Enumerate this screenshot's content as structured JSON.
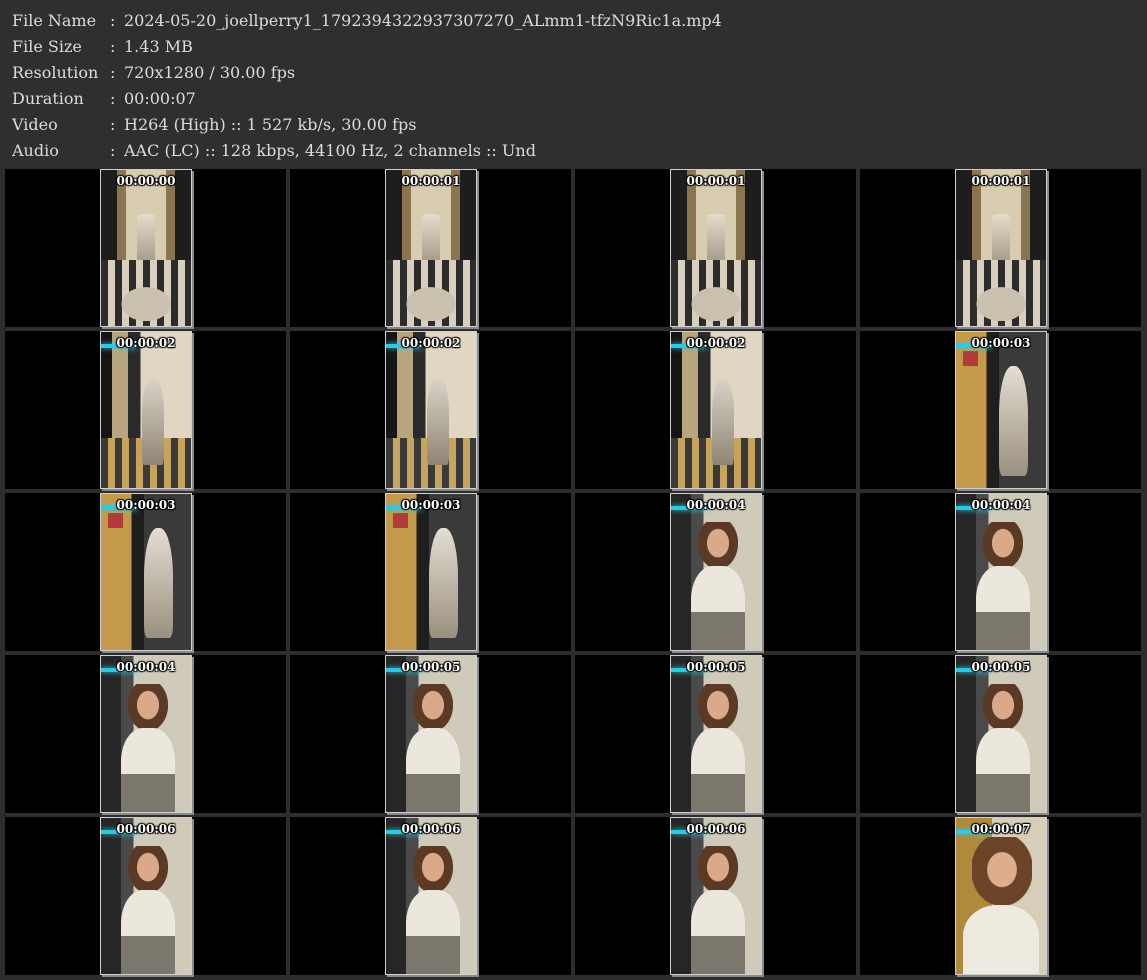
{
  "info": [
    {
      "label": "File Name",
      "sep": ":",
      "value": "2024-05-20_joellperry1_1792394322937307270_ALmm1-tfzN9Ric1a.mp4"
    },
    {
      "label": "File Size",
      "sep": ":",
      "value": "1.43 MB"
    },
    {
      "label": "Resolution",
      "sep": ":",
      "value": "720x1280 / 30.00 fps"
    },
    {
      "label": "Duration",
      "sep": ":",
      "value": "00:00:07"
    },
    {
      "label": "Video",
      "sep": ":",
      "value": "H264 (High) :: 1 527 kb/s, 30.00 fps"
    },
    {
      "label": "Audio",
      "sep": ":",
      "value": "AAC (LC) :: 128 kbps, 44100 Hz, 2 channels :: Und"
    }
  ],
  "thumbnails": [
    {
      "time": "00:00:00",
      "scene": "hall"
    },
    {
      "time": "00:00:01",
      "scene": "hall"
    },
    {
      "time": "00:00:01",
      "scene": "hall"
    },
    {
      "time": "00:00:01",
      "scene": "hall"
    },
    {
      "time": "00:00:02",
      "scene": "door"
    },
    {
      "time": "00:00:02",
      "scene": "door"
    },
    {
      "time": "00:00:02",
      "scene": "door"
    },
    {
      "time": "00:00:03",
      "scene": "elev"
    },
    {
      "time": "00:00:03",
      "scene": "elev"
    },
    {
      "time": "00:00:03",
      "scene": "elev"
    },
    {
      "time": "00:00:04",
      "scene": "person"
    },
    {
      "time": "00:00:04",
      "scene": "person"
    },
    {
      "time": "00:00:04",
      "scene": "person"
    },
    {
      "time": "00:00:05",
      "scene": "person"
    },
    {
      "time": "00:00:05",
      "scene": "person"
    },
    {
      "time": "00:00:05",
      "scene": "person"
    },
    {
      "time": "00:00:06",
      "scene": "person"
    },
    {
      "time": "00:00:06",
      "scene": "person"
    },
    {
      "time": "00:00:06",
      "scene": "person"
    },
    {
      "time": "00:00:07",
      "scene": "close"
    }
  ]
}
